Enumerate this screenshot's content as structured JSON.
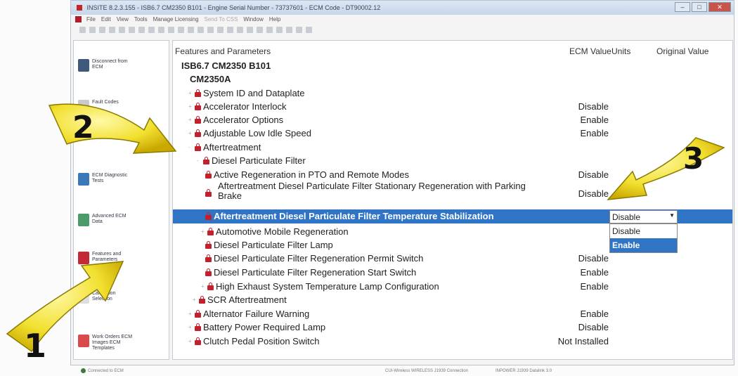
{
  "window": {
    "title": "INSITE 8.2.3.155 - ISB6.7 CM2350 B101 - Engine Serial Number - 73737601 - ECM Code - DT90002.12",
    "controls": [
      "–",
      "□",
      "✕"
    ]
  },
  "menu": {
    "items": [
      "File",
      "Edit",
      "View",
      "Tools",
      "Manage Licensing",
      "Send To CSS",
      "Window",
      "Help"
    ],
    "disabled": [
      false,
      false,
      false,
      false,
      false,
      true,
      false,
      false
    ]
  },
  "sidebar": {
    "items": [
      {
        "label": "Disconnect from ECM",
        "icon": "disconnect-icon",
        "color": "#3f5a7c"
      },
      {
        "label": "Fault Codes",
        "icon": "fault-codes-icon",
        "color": "#c9c9c9"
      },
      {
        "label": "ECM Diagnostic Tests",
        "icon": "ecm-diagnostic-icon",
        "color": "#3b78b8"
      },
      {
        "label": "Advanced ECM Data",
        "icon": "advanced-ecm-icon",
        "color": "#4a9a6a"
      },
      {
        "label": "Features and Parameters",
        "icon": "features-parameters-icon",
        "color": "#c42a36"
      },
      {
        "label": "Calibration Selection",
        "icon": "calibration-icon",
        "color": "#dedede"
      },
      {
        "label": "Work Orders ECM Images ECM Templates",
        "icon": "work-orders-icon",
        "color": "#d94b4b"
      }
    ]
  },
  "tree": {
    "headers": {
      "name": "Features and Parameters",
      "ecm_value": "ECM Value",
      "units": "Units",
      "original_value": "Original Value"
    },
    "rows": [
      {
        "label": "ISB6.7 CM2350 B101",
        "value": "",
        "indent": 0,
        "icon": "none",
        "expander": ""
      },
      {
        "label": "CM2350A",
        "value": "",
        "indent": 1,
        "icon": "none",
        "expander": "-"
      },
      {
        "label": "System ID and Dataplate",
        "value": "",
        "indent": 2,
        "icon": "lock",
        "expander": "+"
      },
      {
        "label": "Accelerator Interlock",
        "value": "Disable",
        "indent": 2,
        "icon": "lock",
        "expander": "+"
      },
      {
        "label": "Accelerator Options",
        "value": "Enable",
        "indent": 2,
        "icon": "lock",
        "expander": "+"
      },
      {
        "label": "Adjustable Low Idle Speed",
        "value": "Enable",
        "indent": 2,
        "icon": "lock",
        "expander": "+"
      },
      {
        "label": "Aftertreatment",
        "value": "",
        "indent": 2,
        "icon": "lock",
        "expander": "-"
      },
      {
        "label": "Diesel Particulate Filter",
        "value": "",
        "indent": 3,
        "icon": "lock",
        "expander": "-"
      },
      {
        "label": "Active Regeneration in PTO and Remote Modes",
        "value": "Disable",
        "indent": 4,
        "icon": "lock",
        "expander": ""
      },
      {
        "label": "Aftertreatment Diesel Particulate Filter Stationary Regeneration with Parking Brake",
        "value": "Disable",
        "indent": 4,
        "icon": "lock",
        "expander": ""
      },
      {
        "label": "Aftertreatment Diesel Particulate Filter Temperature Stabilization",
        "value": "",
        "indent": 4,
        "icon": "lock",
        "expander": "",
        "selected": true
      },
      {
        "label": "Automotive Mobile Regeneration",
        "value": "",
        "indent": 4,
        "icon": "lock",
        "expander": "+"
      },
      {
        "label": "Diesel Particulate Filter Lamp",
        "value": "",
        "indent": 4,
        "icon": "lock",
        "expander": ""
      },
      {
        "label": "Diesel Particulate Filter Regeneration Permit Switch",
        "value": "Disable",
        "indent": 4,
        "icon": "lock",
        "expander": ""
      },
      {
        "label": "Diesel Particulate Filter Regeneration Start Switch",
        "value": "Enable",
        "indent": 4,
        "icon": "lock",
        "expander": ""
      },
      {
        "label": "High Exhaust System Temperature Lamp Configuration",
        "value": "Enable",
        "indent": 4,
        "icon": "lock",
        "expander": "+"
      },
      {
        "label": "SCR Aftertreatment",
        "value": "",
        "indent": 3,
        "icon": "lock",
        "expander": "+"
      },
      {
        "label": "Alternator Failure Warning",
        "value": "Enable",
        "indent": 2,
        "icon": "lock",
        "expander": "+"
      },
      {
        "label": "Battery Power Required Lamp",
        "value": "Disable",
        "indent": 2,
        "icon": "lock",
        "expander": "+"
      },
      {
        "label": "Clutch Pedal Position Switch",
        "value": "Not Installed",
        "indent": 2,
        "icon": "lock",
        "expander": "+"
      }
    ]
  },
  "dropdown": {
    "current": "Disable",
    "options": [
      "Disable",
      "Enable"
    ],
    "highlighted": "Enable"
  },
  "callouts": [
    "1",
    "2",
    "3"
  ],
  "statusbar": {
    "connection": "Connected to ECM",
    "adapter": "CUI-Wireless WIRELESS J1939 Connection",
    "info": "INPOWER J1939 Datalink 3.0"
  },
  "colors": {
    "selection": "#2f74c5",
    "lock": "#c3202e",
    "callout": "#f2e030"
  }
}
